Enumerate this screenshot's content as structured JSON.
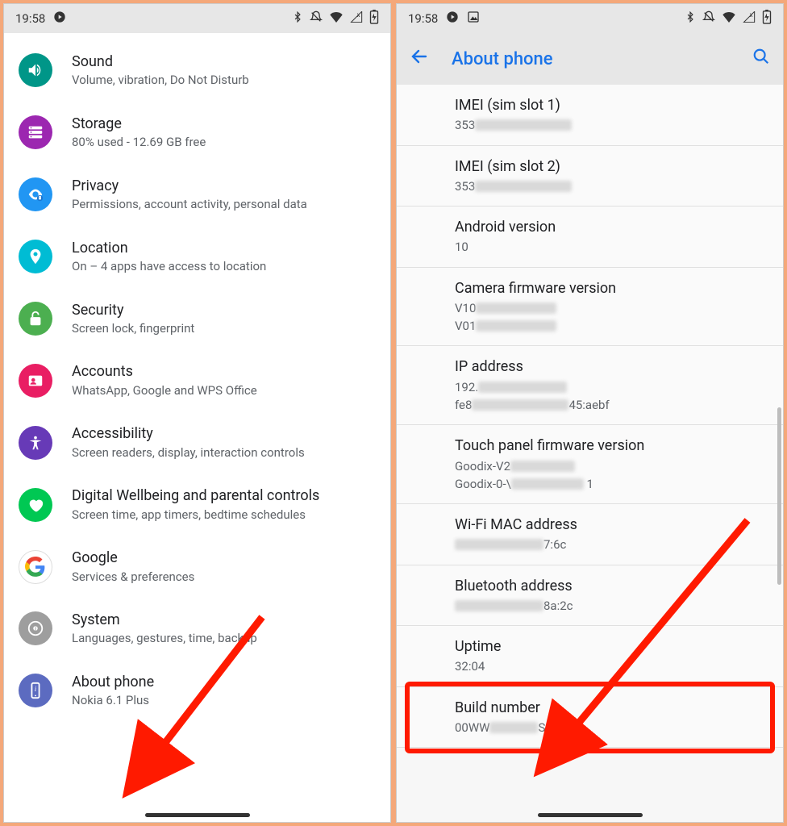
{
  "status": {
    "time": "19:58",
    "left_icons": [
      "play",
      "image"
    ],
    "right_icons": [
      "bluetooth",
      "dnd-off",
      "wifi",
      "signal-off",
      "battery"
    ]
  },
  "left": {
    "items": [
      {
        "icon": "sound",
        "color": "#009688",
        "title": "Sound",
        "sub": "Volume, vibration, Do Not Disturb"
      },
      {
        "icon": "storage",
        "color": "#9c27b0",
        "title": "Storage",
        "sub": "80% used - 12.69 GB free"
      },
      {
        "icon": "privacy",
        "color": "#2196f3",
        "title": "Privacy",
        "sub": "Permissions, account activity, personal data"
      },
      {
        "icon": "location",
        "color": "#00bcd4",
        "title": "Location",
        "sub": "On – 4 apps have access to location"
      },
      {
        "icon": "security",
        "color": "#4caf50",
        "title": "Security",
        "sub": "Screen lock, fingerprint"
      },
      {
        "icon": "accounts",
        "color": "#e91e63",
        "title": "Accounts",
        "sub": "WhatsApp, Google and WPS Office"
      },
      {
        "icon": "accessibility",
        "color": "#673ab7",
        "title": "Accessibility",
        "sub": "Screen readers, display, interaction controls"
      },
      {
        "icon": "wellbeing",
        "color": "#00c853",
        "title": "Digital Wellbeing and parental controls",
        "sub": "Screen time, app timers, bedtime schedules"
      },
      {
        "icon": "google",
        "color": "#ffffff",
        "title": "Google",
        "sub": "Services & preferences"
      },
      {
        "icon": "system",
        "color": "#9e9e9e",
        "title": "System",
        "sub": "Languages, gestures, time, backup"
      },
      {
        "icon": "about",
        "color": "#5c6bc0",
        "title": "About phone",
        "sub": "Nokia 6.1 Plus"
      }
    ]
  },
  "right": {
    "header": "About phone",
    "items": [
      {
        "title": "IMEI (sim slot 1)",
        "sub": "353",
        "blur_after": 120
      },
      {
        "title": "IMEI (sim slot 2)",
        "sub": "353",
        "blur_after": 120
      },
      {
        "title": "Android version",
        "sub": "10"
      },
      {
        "title": "Camera firmware version",
        "sub": "V10",
        "sub2": "V01",
        "blur_after": 100,
        "blur_after2": 100
      },
      {
        "title": "IP address",
        "sub": "192.",
        "sub2_pre": "fe8",
        "sub2_suf": "45:aebf",
        "blur_after": 110,
        "blur_mid": 120
      },
      {
        "title": "Touch panel firmware version",
        "sub": "Goodix-V2",
        "sub2_pre": "Goodix-0-\\",
        "sub2_suf": " 1",
        "blur_after": 80,
        "blur_mid": 90
      },
      {
        "title": "Wi-Fi MAC address",
        "sub_pre": "",
        "sub_suf": "7:6c",
        "blur_before": 110
      },
      {
        "title": "Bluetooth address",
        "sub_pre": "",
        "sub_suf": "8a:2c",
        "blur_before": 110
      },
      {
        "title": "Uptime",
        "sub": "32:04"
      },
      {
        "title": "Build number",
        "sub_pre": "00WW",
        "sub_suf": "SP09",
        "blur_mid": 60,
        "highlight": true
      }
    ]
  }
}
